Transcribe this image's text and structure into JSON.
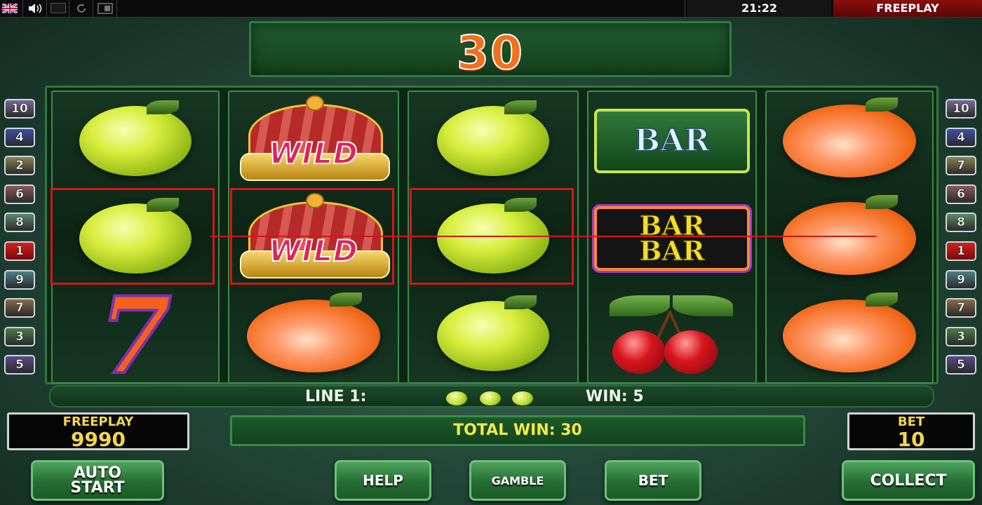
{
  "topbar": {
    "flag_icon": "uk-flag-icon",
    "sound_icon": "speaker-icon",
    "clock": "21:22",
    "mode": "FREEPLAY"
  },
  "win_display": {
    "value": "30"
  },
  "reels": [
    [
      "lemon",
      "lemon",
      "seven"
    ],
    [
      "wild",
      "wild",
      "orange"
    ],
    [
      "lemon",
      "lemon",
      "lemon"
    ],
    [
      "bar",
      "bar-bar",
      "cherry"
    ],
    [
      "orange",
      "orange",
      "orange"
    ]
  ],
  "symbol_text": {
    "wild": "WILD",
    "bar": "BAR",
    "bar_bar_top": "BAR",
    "bar_bar_bottom": "BAR",
    "seven": "7"
  },
  "left_lines": [
    {
      "n": "10",
      "color": "#7a6a9a"
    },
    {
      "n": "4",
      "color": "#3f4fa8"
    },
    {
      "n": "2",
      "color": "#8a8250"
    },
    {
      "n": "6",
      "color": "#8a5a55"
    },
    {
      "n": "8",
      "color": "#5a8a6a"
    },
    {
      "n": "1",
      "color": "#c81818"
    },
    {
      "n": "9",
      "color": "#4f7f8a"
    },
    {
      "n": "7",
      "color": "#8a6a48"
    },
    {
      "n": "3",
      "color": "#4d7d48"
    },
    {
      "n": "5",
      "color": "#5a4a8a"
    }
  ],
  "right_lines": [
    {
      "n": "10",
      "color": "#7a6a9a"
    },
    {
      "n": "4",
      "color": "#3f4fa8"
    },
    {
      "n": "7",
      "color": "#8a8250"
    },
    {
      "n": "6",
      "color": "#8a5a55"
    },
    {
      "n": "8",
      "color": "#5a8a6a"
    },
    {
      "n": "1",
      "color": "#c81818"
    },
    {
      "n": "9",
      "color": "#4f7f8a"
    },
    {
      "n": "7",
      "color": "#8a6a48"
    },
    {
      "n": "3",
      "color": "#4d7d48"
    },
    {
      "n": "5",
      "color": "#5a4a8a"
    }
  ],
  "info": {
    "line_label": "LINE 1:",
    "win_label": "WIN: 5"
  },
  "balance": {
    "label": "FREEPLAY",
    "value": "9990"
  },
  "total_win": "TOTAL WIN: 30",
  "bet": {
    "label": "BET",
    "value": "10"
  },
  "buttons": {
    "auto_start_1": "AUTO",
    "auto_start_2": "START",
    "help": "HELP",
    "gamble": "GAMBLE",
    "bet": "BET",
    "collect": "COLLECT"
  }
}
